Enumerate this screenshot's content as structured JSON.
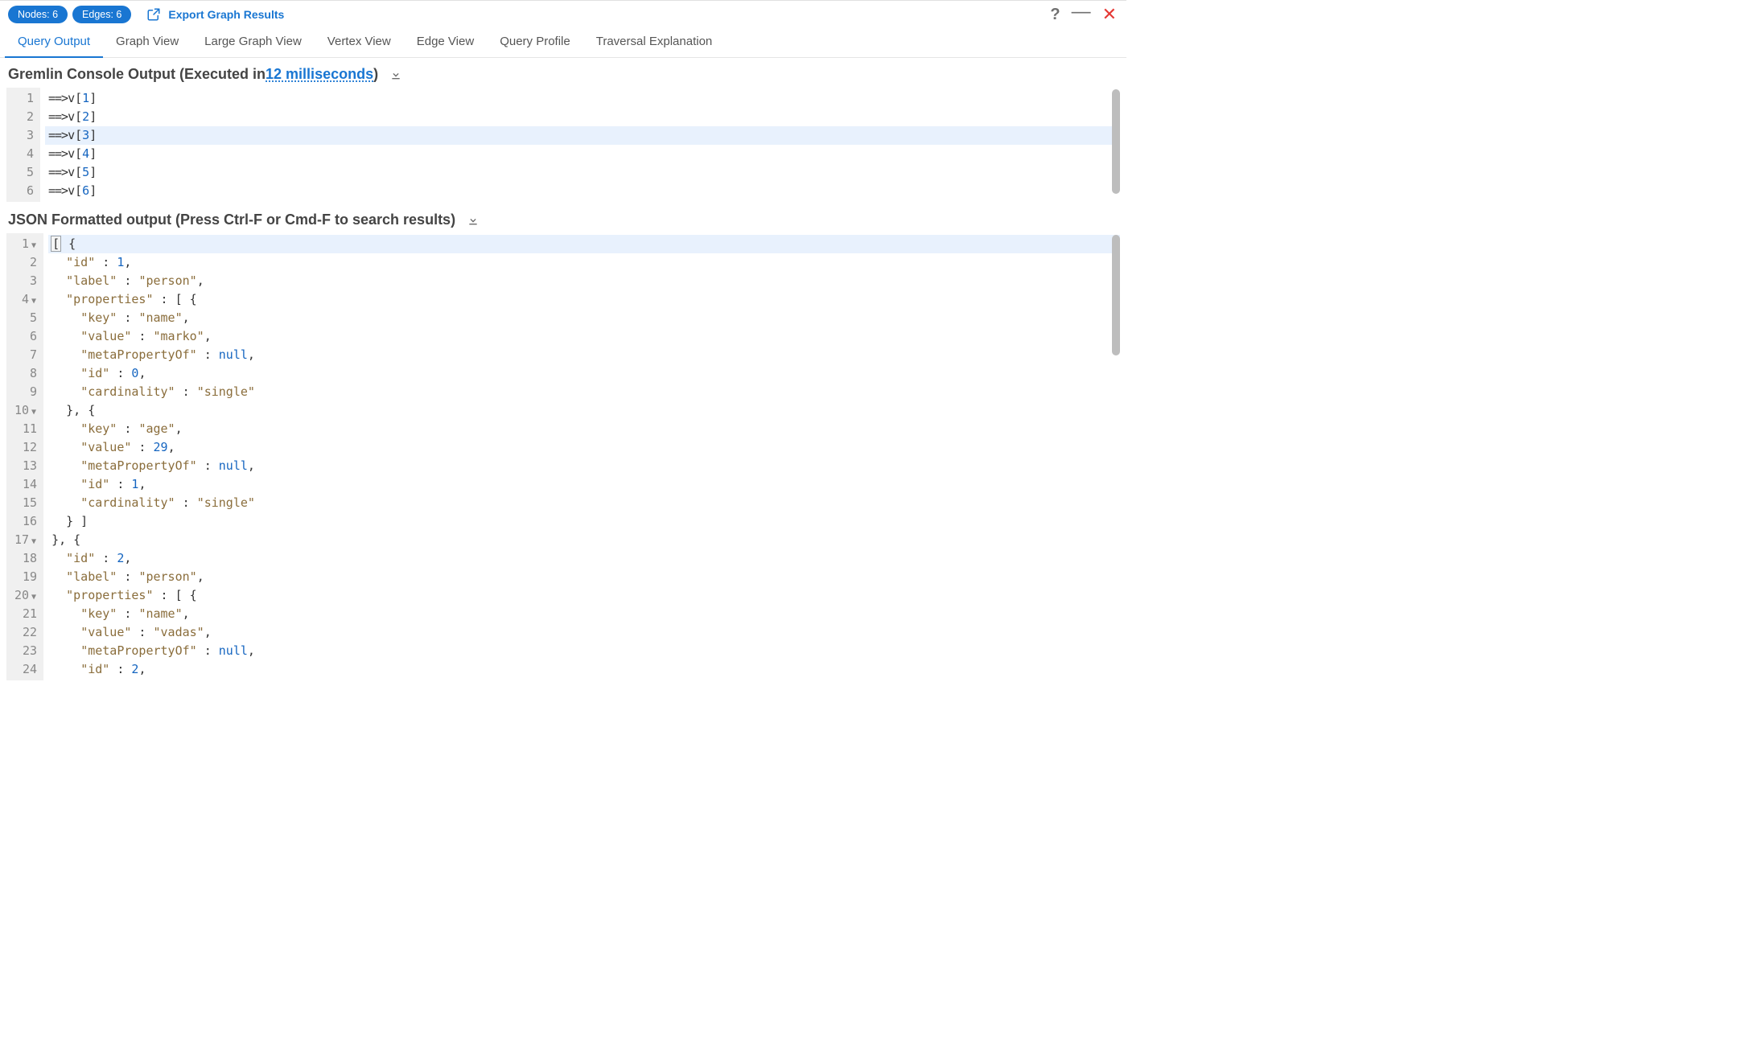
{
  "toolbar": {
    "nodes_label": "Nodes: 6",
    "edges_label": "Edges: 6",
    "export_label": "Export Graph Results"
  },
  "tabs": [
    {
      "label": "Query Output",
      "active": true
    },
    {
      "label": "Graph View",
      "active": false
    },
    {
      "label": "Large Graph View",
      "active": false
    },
    {
      "label": "Vertex View",
      "active": false
    },
    {
      "label": "Edge View",
      "active": false
    },
    {
      "label": "Query Profile",
      "active": false
    },
    {
      "label": "Traversal Explanation",
      "active": false
    }
  ],
  "console_section": {
    "title_prefix": "Gremlin Console Output (Executed in ",
    "exec_time": "12 milliseconds",
    "title_suffix": ")"
  },
  "console_lines": [
    {
      "n": "1",
      "text": "==>v[1]"
    },
    {
      "n": "2",
      "text": "==>v[2]"
    },
    {
      "n": "3",
      "text": "==>v[3]",
      "hl": true
    },
    {
      "n": "4",
      "text": "==>v[4]"
    },
    {
      "n": "5",
      "text": "==>v[5]"
    },
    {
      "n": "6",
      "text": "==>v[6]"
    }
  ],
  "json_section": {
    "title": "JSON Formatted output (Press Ctrl-F or Cmd-F to search results)"
  },
  "json_lines": [
    {
      "n": "1",
      "fold": true,
      "hl": true,
      "tokens": [
        {
          "t": "brhl",
          "v": "["
        },
        {
          "t": "p",
          "v": " {"
        }
      ]
    },
    {
      "n": "2",
      "tokens": [
        {
          "t": "p",
          "v": "  "
        },
        {
          "t": "key",
          "v": "\"id\""
        },
        {
          "t": "p",
          "v": " : "
        },
        {
          "t": "num",
          "v": "1"
        },
        {
          "t": "p",
          "v": ","
        }
      ]
    },
    {
      "n": "3",
      "tokens": [
        {
          "t": "p",
          "v": "  "
        },
        {
          "t": "key",
          "v": "\"label\""
        },
        {
          "t": "p",
          "v": " : "
        },
        {
          "t": "str",
          "v": "\"person\""
        },
        {
          "t": "p",
          "v": ","
        }
      ]
    },
    {
      "n": "4",
      "fold": true,
      "tokens": [
        {
          "t": "p",
          "v": "  "
        },
        {
          "t": "key",
          "v": "\"properties\""
        },
        {
          "t": "p",
          "v": " : [ {"
        }
      ]
    },
    {
      "n": "5",
      "tokens": [
        {
          "t": "p",
          "v": "    "
        },
        {
          "t": "key",
          "v": "\"key\""
        },
        {
          "t": "p",
          "v": " : "
        },
        {
          "t": "str",
          "v": "\"name\""
        },
        {
          "t": "p",
          "v": ","
        }
      ]
    },
    {
      "n": "6",
      "tokens": [
        {
          "t": "p",
          "v": "    "
        },
        {
          "t": "key",
          "v": "\"value\""
        },
        {
          "t": "p",
          "v": " : "
        },
        {
          "t": "str",
          "v": "\"marko\""
        },
        {
          "t": "p",
          "v": ","
        }
      ]
    },
    {
      "n": "7",
      "tokens": [
        {
          "t": "p",
          "v": "    "
        },
        {
          "t": "key",
          "v": "\"metaPropertyOf\""
        },
        {
          "t": "p",
          "v": " : "
        },
        {
          "t": "null",
          "v": "null"
        },
        {
          "t": "p",
          "v": ","
        }
      ]
    },
    {
      "n": "8",
      "tokens": [
        {
          "t": "p",
          "v": "    "
        },
        {
          "t": "key",
          "v": "\"id\""
        },
        {
          "t": "p",
          "v": " : "
        },
        {
          "t": "num",
          "v": "0"
        },
        {
          "t": "p",
          "v": ","
        }
      ]
    },
    {
      "n": "9",
      "tokens": [
        {
          "t": "p",
          "v": "    "
        },
        {
          "t": "key",
          "v": "\"cardinality\""
        },
        {
          "t": "p",
          "v": " : "
        },
        {
          "t": "str",
          "v": "\"single\""
        }
      ]
    },
    {
      "n": "10",
      "fold": true,
      "tokens": [
        {
          "t": "p",
          "v": "  }, {"
        }
      ]
    },
    {
      "n": "11",
      "tokens": [
        {
          "t": "p",
          "v": "    "
        },
        {
          "t": "key",
          "v": "\"key\""
        },
        {
          "t": "p",
          "v": " : "
        },
        {
          "t": "str",
          "v": "\"age\""
        },
        {
          "t": "p",
          "v": ","
        }
      ]
    },
    {
      "n": "12",
      "tokens": [
        {
          "t": "p",
          "v": "    "
        },
        {
          "t": "key",
          "v": "\"value\""
        },
        {
          "t": "p",
          "v": " : "
        },
        {
          "t": "num",
          "v": "29"
        },
        {
          "t": "p",
          "v": ","
        }
      ]
    },
    {
      "n": "13",
      "tokens": [
        {
          "t": "p",
          "v": "    "
        },
        {
          "t": "key",
          "v": "\"metaPropertyOf\""
        },
        {
          "t": "p",
          "v": " : "
        },
        {
          "t": "null",
          "v": "null"
        },
        {
          "t": "p",
          "v": ","
        }
      ]
    },
    {
      "n": "14",
      "tokens": [
        {
          "t": "p",
          "v": "    "
        },
        {
          "t": "key",
          "v": "\"id\""
        },
        {
          "t": "p",
          "v": " : "
        },
        {
          "t": "num",
          "v": "1"
        },
        {
          "t": "p",
          "v": ","
        }
      ]
    },
    {
      "n": "15",
      "tokens": [
        {
          "t": "p",
          "v": "    "
        },
        {
          "t": "key",
          "v": "\"cardinality\""
        },
        {
          "t": "p",
          "v": " : "
        },
        {
          "t": "str",
          "v": "\"single\""
        }
      ]
    },
    {
      "n": "16",
      "tokens": [
        {
          "t": "p",
          "v": "  } ]"
        }
      ]
    },
    {
      "n": "17",
      "fold": true,
      "tokens": [
        {
          "t": "p",
          "v": "}, {"
        }
      ]
    },
    {
      "n": "18",
      "tokens": [
        {
          "t": "p",
          "v": "  "
        },
        {
          "t": "key",
          "v": "\"id\""
        },
        {
          "t": "p",
          "v": " : "
        },
        {
          "t": "num",
          "v": "2"
        },
        {
          "t": "p",
          "v": ","
        }
      ]
    },
    {
      "n": "19",
      "tokens": [
        {
          "t": "p",
          "v": "  "
        },
        {
          "t": "key",
          "v": "\"label\""
        },
        {
          "t": "p",
          "v": " : "
        },
        {
          "t": "str",
          "v": "\"person\""
        },
        {
          "t": "p",
          "v": ","
        }
      ]
    },
    {
      "n": "20",
      "fold": true,
      "tokens": [
        {
          "t": "p",
          "v": "  "
        },
        {
          "t": "key",
          "v": "\"properties\""
        },
        {
          "t": "p",
          "v": " : [ {"
        }
      ]
    },
    {
      "n": "21",
      "tokens": [
        {
          "t": "p",
          "v": "    "
        },
        {
          "t": "key",
          "v": "\"key\""
        },
        {
          "t": "p",
          "v": " : "
        },
        {
          "t": "str",
          "v": "\"name\""
        },
        {
          "t": "p",
          "v": ","
        }
      ]
    },
    {
      "n": "22",
      "tokens": [
        {
          "t": "p",
          "v": "    "
        },
        {
          "t": "key",
          "v": "\"value\""
        },
        {
          "t": "p",
          "v": " : "
        },
        {
          "t": "str",
          "v": "\"vadas\""
        },
        {
          "t": "p",
          "v": ","
        }
      ]
    },
    {
      "n": "23",
      "tokens": [
        {
          "t": "p",
          "v": "    "
        },
        {
          "t": "key",
          "v": "\"metaPropertyOf\""
        },
        {
          "t": "p",
          "v": " : "
        },
        {
          "t": "null",
          "v": "null"
        },
        {
          "t": "p",
          "v": ","
        }
      ]
    },
    {
      "n": "24",
      "tokens": [
        {
          "t": "p",
          "v": "    "
        },
        {
          "t": "key",
          "v": "\"id\""
        },
        {
          "t": "p",
          "v": " : "
        },
        {
          "t": "num",
          "v": "2"
        },
        {
          "t": "p",
          "v": ","
        }
      ]
    }
  ]
}
